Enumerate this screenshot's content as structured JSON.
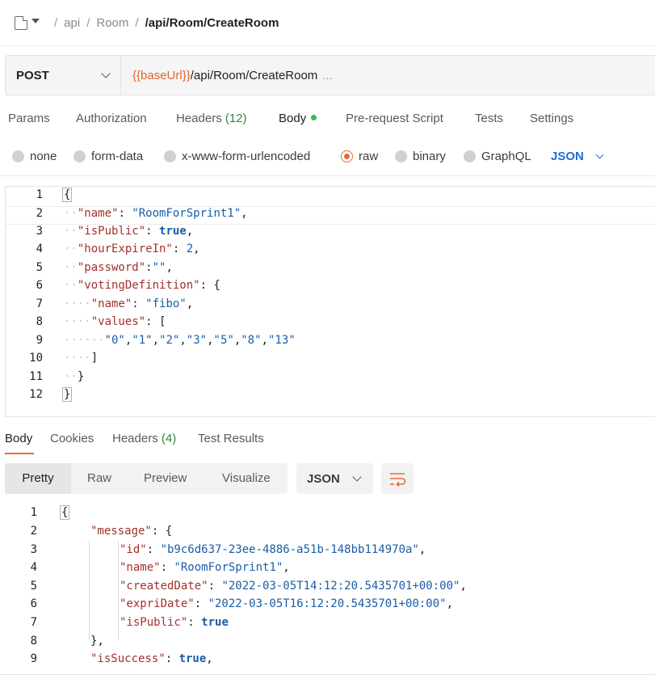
{
  "breadcrumb": {
    "parts": [
      "api",
      "Room"
    ],
    "current": "/api/Room/CreateRoom"
  },
  "request": {
    "method": "POST",
    "url_var": "{{baseUrl}}",
    "url_path": "/api/Room/CreateRoom",
    "url_more": "..."
  },
  "request_tabs": {
    "params": "Params",
    "authorization": "Authorization",
    "headers": "Headers",
    "headers_count": "(12)",
    "body": "Body",
    "prerequest": "Pre-request Script",
    "tests": "Tests",
    "settings": "Settings"
  },
  "body_types": {
    "none": "none",
    "form_data": "form-data",
    "urlencoded": "x-www-form-urlencoded",
    "raw": "raw",
    "binary": "binary",
    "graphql": "GraphQL",
    "selected": "raw",
    "format": "JSON"
  },
  "request_body": {
    "line_numbers": [
      "1",
      "2",
      "3",
      "4",
      "5",
      "6",
      "7",
      "8",
      "9",
      "10",
      "11",
      "12"
    ]
  },
  "response_tabs": {
    "body": "Body",
    "cookies": "Cookies",
    "headers": "Headers",
    "headers_count": "(4)",
    "test_results": "Test Results"
  },
  "response_view": {
    "pretty": "Pretty",
    "raw": "Raw",
    "preview": "Preview",
    "visualize": "Visualize",
    "format": "JSON"
  },
  "response_body": {
    "line_numbers": [
      "1",
      "2",
      "3",
      "4",
      "5",
      "6",
      "7",
      "8",
      "9"
    ],
    "id": "\"b9c6d637-23ee-4886-a51b-148bb114970a\"",
    "name": "\"RoomForSprint1\"",
    "createdDate": "\"2022-03-05T14:12:20.5435701+00:00\"",
    "expriDate": "\"2022-03-05T16:12:20.5435701+00:00\""
  },
  "colors": {
    "accent": "#e86a3c",
    "url_variable": "#e3652f",
    "json_key": "#a2312a",
    "json_value": "#1a5ca8",
    "count_green": "#2b8a3e",
    "dot_green": "#2fbf4a",
    "select_blue": "#1f6fd1"
  }
}
